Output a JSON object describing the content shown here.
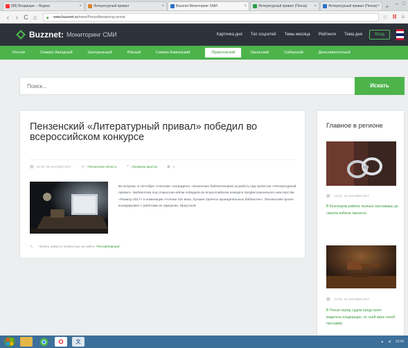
{
  "browser": {
    "tabs": [
      {
        "title": "(88) Входящие – Яндекс",
        "color": "#ff3333",
        "active": false
      },
      {
        "title": "Литературный привал",
        "color": "#d9822b",
        "active": false
      },
      {
        "title": "Buzznet Мониторинг СМИ",
        "color": "#2d6fc4",
        "active": true
      },
      {
        "title": "Литературный привал (Пенза)",
        "color": "#2a9d48",
        "active": false
      },
      {
        "title": "Литературный привал (Пенза)",
        "color": "#2d6fc4",
        "active": false
      }
    ],
    "new_tab": "+",
    "address": {
      "domain": "www.buzznet.ru",
      "path": "/news/Penza/literaturnyy-privat"
    },
    "nav": {
      "back": "‹",
      "forward": "›",
      "reload": "C",
      "home": "⌂"
    }
  },
  "site": {
    "logo_name": "Buzznet:",
    "logo_sub": "Мониторинг СМИ",
    "topnav": [
      "Карточка дня",
      "Топ соцсетей",
      "Темы месяца",
      "Рейтинги",
      "Тема дня"
    ],
    "login": "Вход",
    "regions": [
      {
        "label": "Россия",
        "active": false
      },
      {
        "label": "Северо-Западный",
        "active": false
      },
      {
        "label": "Центральный",
        "active": false
      },
      {
        "label": "Южный",
        "active": false
      },
      {
        "label": "Северо-Кавказский",
        "active": false
      },
      {
        "label": "Приволжский",
        "active": true
      },
      {
        "label": "Уральский",
        "active": false
      },
      {
        "label": "Сибирский",
        "active": false
      },
      {
        "label": "Дальневосточный",
        "active": false
      }
    ]
  },
  "search": {
    "placeholder": "Поиск...",
    "button": "Искать"
  },
  "article": {
    "title": "Пензенский «Литературный привал» победил во всероссийском конкурсе",
    "date": "16:30, 06 сентября 2017",
    "region": "Пензенская область",
    "category": "Проверка фактов",
    "views": "4",
    "body": "Во вторник, 5 сентября, в Москве «наградили» пензенских библиотекарей за работу над проектом «Литературный привал». Библиотека под открытым небом победила во всероссийском конкурсе профессионального мастерства «Ремиор 2017» в номинации «Чтение XXI века. Лучшие проекты муниципальных библиотек». Пензенский проект конкурировал с работами из Удмуртии, Иркутской,",
    "source_prefix": "Читать новость полностью на сайте",
    "source_name": "\"ПензаИнформ\""
  },
  "sidebar": {
    "title": "Главное в регионе",
    "items": [
      {
        "time": "14:01, 12 сентября 2017",
        "text": "В Кузнецком районе пьяные пассажиры до смерти избили таксиста"
      },
      {
        "time": "13:20, 12 сентября 2017",
        "text": "В Пензе перед судом предстанет водитель-кладорщик, по чьей вине погиб пассажир"
      }
    ]
  },
  "colors": {
    "accent_green": "#4db44c",
    "header_dark": "#2d323a",
    "link_green": "#3a9b3f"
  },
  "taskbar": {
    "tray_time": "13:43"
  }
}
